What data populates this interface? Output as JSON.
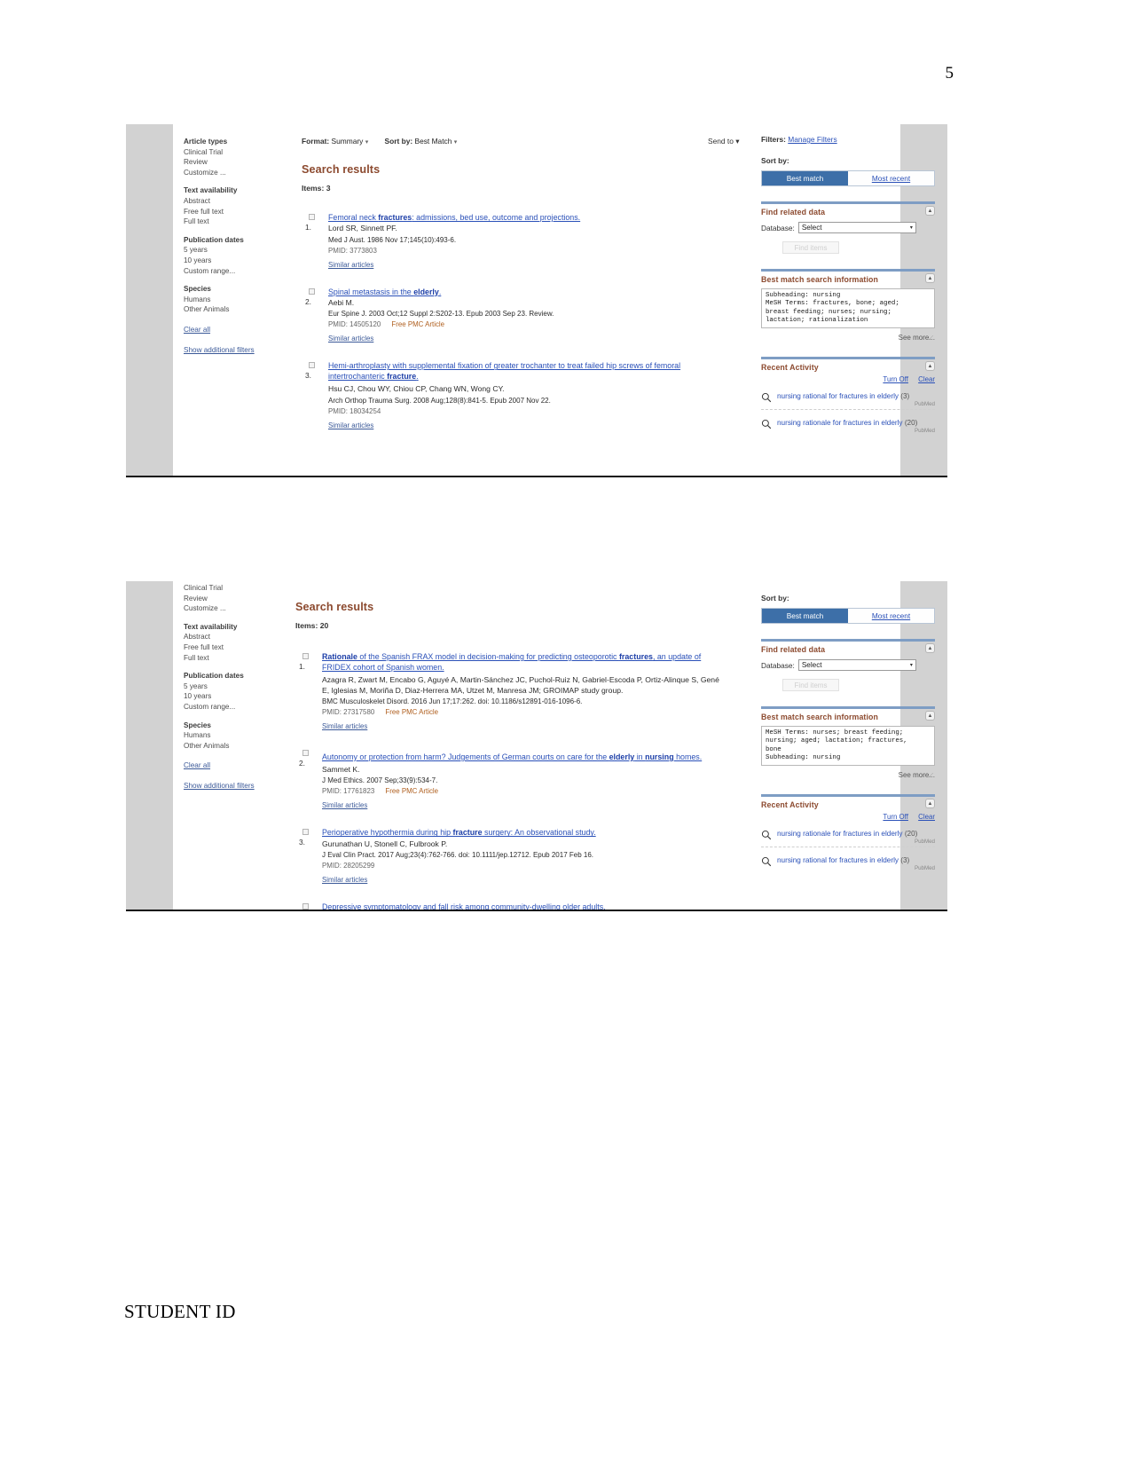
{
  "document": {
    "page_number": "5",
    "footer_text": "STUDENT ID"
  },
  "screenshot_one": {
    "toolbar": {
      "format_label": "Format:",
      "format_value": "Summary",
      "sort_label": "Sort by:",
      "sort_value": "Best Match",
      "caret": "▾",
      "send_to": "Send to",
      "filters_label": "Filters:",
      "manage_filters": "Manage Filters"
    },
    "facets": [
      {
        "head": "Article types",
        "items": [
          "Clinical Trial",
          "Review",
          "Customize ..."
        ]
      },
      {
        "head": "Text availability",
        "items": [
          "Abstract",
          "Free full text",
          "Full text"
        ]
      },
      {
        "head": "Publication dates",
        "items": [
          "5 years",
          "10 years",
          "Custom range..."
        ]
      },
      {
        "head": "Species",
        "items": [
          "Humans",
          "Other Animals"
        ]
      }
    ],
    "facet_links": [
      "Clear all",
      "Show additional filters"
    ],
    "results_heading": "Search results",
    "items_count": "Items: 3",
    "results": [
      {
        "number": "1.",
        "title_parts": [
          {
            "t": "Femoral neck ",
            "b": false
          },
          {
            "t": "fractures",
            "b": true
          },
          {
            "t": ": admissions, bed use, outcome and projections.",
            "b": false
          }
        ],
        "authors": "Lord SR, Sinnett PF.",
        "journal": "Med J Aust. 1986 Nov 17;145(10):493-6.",
        "pmid": "PMID: 3773803",
        "free_text": "",
        "similar": "Similar articles"
      },
      {
        "number": "2.",
        "title_parts": [
          {
            "t": "Spinal metastasis in the ",
            "b": false
          },
          {
            "t": "elderly",
            "b": true
          },
          {
            "t": ".",
            "b": false
          }
        ],
        "authors": "Aebi M.",
        "journal": "Eur Spine J. 2003 Oct;12 Suppl 2:S202-13. Epub 2003 Sep 23. Review.",
        "pmid": "PMID: 14505120",
        "free_text": "Free PMC Article",
        "similar": "Similar articles"
      },
      {
        "number": "3.",
        "title_parts": [
          {
            "t": "Hemi-arthroplasty with supplemental fixation of greater trochanter to treat failed hip screws of femoral intertrochanteric ",
            "b": false
          },
          {
            "t": "fracture",
            "b": true
          },
          {
            "t": ".",
            "b": false
          }
        ],
        "authors": "Hsu CJ, Chou WY, Chiou CP, Chang WN, Wong CY.",
        "journal": "Arch Orthop Trauma Surg. 2008 Aug;128(8):841-5. Epub 2007 Nov 22.",
        "pmid": "PMID: 18034254",
        "free_text": "",
        "similar": "Similar articles"
      }
    ],
    "sidebar": {
      "sort_by_label": "Sort by:",
      "tab_best_match": "Best match",
      "tab_most_recent": "Most recent",
      "find_related_title": "Find related data",
      "database_label": "Database:",
      "database_value": "Select",
      "find_items_label": "Find items",
      "best_match_title": "Best match search information",
      "best_match_text": "Subheading: nursing\nMeSH Terms: fractures, bone; aged;\nbreast feeding; nurses; nursing;\nlactation; rationalization",
      "see_more": "See more...",
      "recent_activity_title": "Recent Activity",
      "turn_off": "Turn Off",
      "clear": "Clear",
      "activity": [
        {
          "text": "nursing rational for fractures in elderly",
          "count": "(3)",
          "source": "PubMed"
        },
        {
          "text": "nursing rationale for fractures in elderly",
          "count": "(20)",
          "source": "PubMed"
        }
      ]
    }
  },
  "screenshot_two": {
    "facets": [
      {
        "head": "",
        "items": [
          "Clinical Trial",
          "Review",
          "Customize ..."
        ]
      },
      {
        "head": "Text availability",
        "items": [
          "Abstract",
          "Free full text",
          "Full text"
        ]
      },
      {
        "head": "Publication dates",
        "items": [
          "5 years",
          "10 years",
          "Custom range..."
        ]
      },
      {
        "head": "Species",
        "items": [
          "Humans",
          "Other Animals"
        ]
      }
    ],
    "facet_links": [
      "Clear all",
      "Show additional filters"
    ],
    "results_heading": "Search results",
    "items_count": "Items: 20",
    "results": [
      {
        "number": "1.",
        "title_parts": [
          {
            "t": "Rationale",
            "b": true
          },
          {
            "t": " of the Spanish FRAX model in decision-making for predicting osteoporotic ",
            "b": false
          },
          {
            "t": "fractures",
            "b": true
          },
          {
            "t": ", an update of FRIDEX cohort of Spanish women.",
            "b": false
          }
        ],
        "authors": "Azagra R, Zwart M, Encabo G, Aguyé A, Martin-Sánchez JC, Puchol-Ruiz N, Gabriel-Escoda P, Ortiz-Alinque S, Gené E, Iglesias M, Moriña D, Diaz-Herrera MA, Utzet M, Manresa JM; GROIMAP study group.",
        "journal": "BMC Musculoskelet Disord. 2016 Jun 17;17:262. doi: 10.1186/s12891-016-1096-6.",
        "pmid": "PMID: 27317580",
        "free_text": "Free PMC Article",
        "similar": "Similar articles"
      },
      {
        "number": "2.",
        "title_parts": [
          {
            "t": "Autonomy or protection from harm? Judgements of German courts on care for the ",
            "b": false
          },
          {
            "t": "elderly",
            "b": true
          },
          {
            "t": " in ",
            "b": false
          },
          {
            "t": "nursing",
            "b": true
          },
          {
            "t": " homes.",
            "b": false
          }
        ],
        "authors": "Sammet K.",
        "journal": "J Med Ethics. 2007 Sep;33(9):534-7.",
        "pmid": "PMID: 17761823",
        "free_text": "Free PMC Article",
        "similar": "Similar articles"
      },
      {
        "number": "3.",
        "title_parts": [
          {
            "t": "Perioperative hypothermia during hip ",
            "b": false
          },
          {
            "t": "fracture",
            "b": true
          },
          {
            "t": " surgery: An observational study.",
            "b": false
          }
        ],
        "authors": "Gurunathan U, Stonell C, Fulbrook P.",
        "journal": "J Eval Clin Pract. 2017 Aug;23(4):762-766. doi: 10.1111/jep.12712. Epub 2017 Feb 16.",
        "pmid": "PMID: 28205299",
        "free_text": "",
        "similar": "Similar articles"
      },
      {
        "number": "4.",
        "title_parts": [
          {
            "t": "Depressive symptomatology and fall risk among community-dwelling older adults.",
            "b": false
          }
        ],
        "authors": "",
        "journal": "",
        "pmid": "",
        "free_text": "",
        "similar": ""
      }
    ],
    "sidebar": {
      "sort_by_label": "Sort by:",
      "tab_best_match": "Best match",
      "tab_most_recent": "Most recent",
      "find_related_title": "Find related data",
      "database_label": "Database:",
      "database_value": "Select",
      "find_items_label": "Find items",
      "best_match_title": "Best match search information",
      "best_match_text": "MeSH Terms: nurses; breast feeding;\nnursing; aged; lactation; fractures,\nbone\nSubheading: nursing",
      "see_more": "See more...",
      "recent_activity_title": "Recent Activity",
      "turn_off": "Turn Off",
      "clear": "Clear",
      "activity": [
        {
          "text": "nursing rationale for fractures in elderly",
          "count": "(20)",
          "source": "PubMed"
        },
        {
          "text": "nursing rational for fractures in elderly",
          "count": "(3)",
          "source": "PubMed"
        }
      ]
    }
  },
  "icons": {
    "collapse": "▲",
    "dropdown_arrow": "▾",
    "search": "search-icon"
  },
  "colors": {
    "accent_heading": "#8c4a2f",
    "link": "#2a50b8",
    "tab_active_bg": "#3d6fa8",
    "portlet_bar": "#7e9dc4",
    "page_gutter": "#d2d2d2"
  }
}
